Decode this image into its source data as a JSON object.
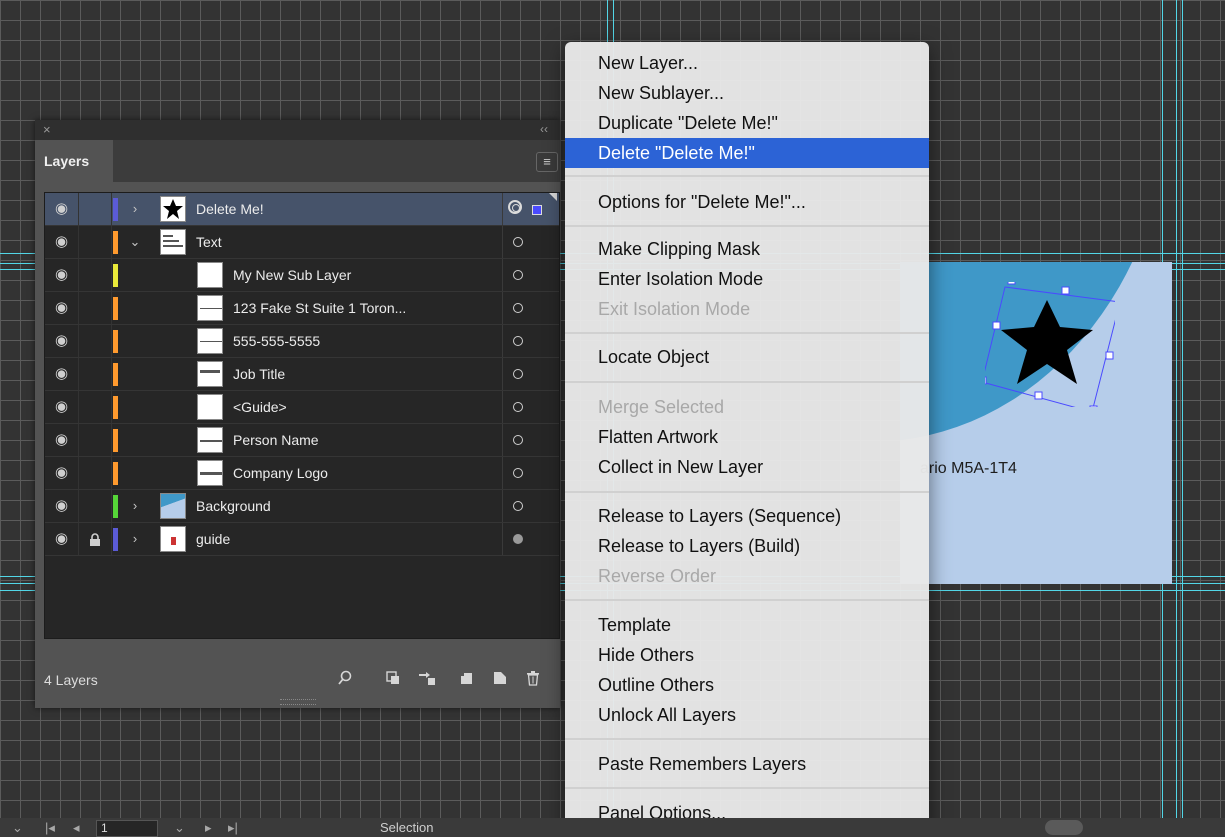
{
  "colors": {
    "highlight": "#2c63d6",
    "guide": "#52d6e6",
    "layer_colors": [
      "#5b5bd6",
      "#ff9a2e",
      "#eaea3a",
      "#56d638",
      "#5b5bd6"
    ]
  },
  "layers_panel": {
    "close_icon": "×",
    "collapse_icon": "‹‹",
    "tab_label": "Layers",
    "menu_icon": "≡",
    "rows": [
      {
        "name": "Delete Me!",
        "visible": true,
        "locked": false,
        "expanded": false,
        "selected": true,
        "eye": "eye-icon"
      },
      {
        "name": "Text",
        "visible": true,
        "locked": false,
        "expanded": true,
        "selected": false
      },
      {
        "name": "My New Sub Layer"
      },
      {
        "name": "123 Fake St Suite 1 Toron..."
      },
      {
        "name": "555-555-5555"
      },
      {
        "name": "Job Title"
      },
      {
        "name": "<Guide>"
      },
      {
        "name": "Person Name"
      },
      {
        "name": "Company Logo"
      },
      {
        "name": "Background"
      },
      {
        "name": "guide",
        "locked": true
      }
    ],
    "eye_glyph": "◉",
    "lock_glyph": "🔒",
    "chevron_right": "›",
    "chevron_down": "⌄",
    "footer": {
      "count_label": "4 Layers",
      "icons": [
        "search-icon",
        "clipping-mask-icon",
        "move-to-layer-icon",
        "new-layer-icon",
        "trash-icon"
      ]
    }
  },
  "context_menu": {
    "items": [
      {
        "label": "New Layer..."
      },
      {
        "label": "New Sublayer..."
      },
      {
        "label": "Duplicate \"Delete Me!\""
      },
      {
        "label": "Delete \"Delete Me!\"",
        "state": "highlighted"
      },
      {
        "label": "Options for \"Delete Me!\"..."
      },
      {
        "label": "Make Clipping Mask"
      },
      {
        "label": "Enter Isolation Mode"
      },
      {
        "label": "Exit Isolation Mode",
        "state": "disabled"
      },
      {
        "label": "Locate Object"
      },
      {
        "label": "Merge Selected",
        "state": "disabled"
      },
      {
        "label": "Flatten Artwork"
      },
      {
        "label": "Collect in New Layer"
      },
      {
        "label": "Release to Layers (Sequence)"
      },
      {
        "label": "Release to Layers (Build)"
      },
      {
        "label": "Reverse Order",
        "state": "disabled"
      },
      {
        "label": "Template"
      },
      {
        "label": "Hide Others"
      },
      {
        "label": "Outline Others"
      },
      {
        "label": "Unlock All Layers"
      },
      {
        "label": "Paste Remembers Layers"
      },
      {
        "label": "Panel Options..."
      }
    ]
  },
  "artboard": {
    "address_text": "ario M5A-1T4"
  },
  "statusbar": {
    "page_value": "1",
    "tool_label": "Selection"
  }
}
